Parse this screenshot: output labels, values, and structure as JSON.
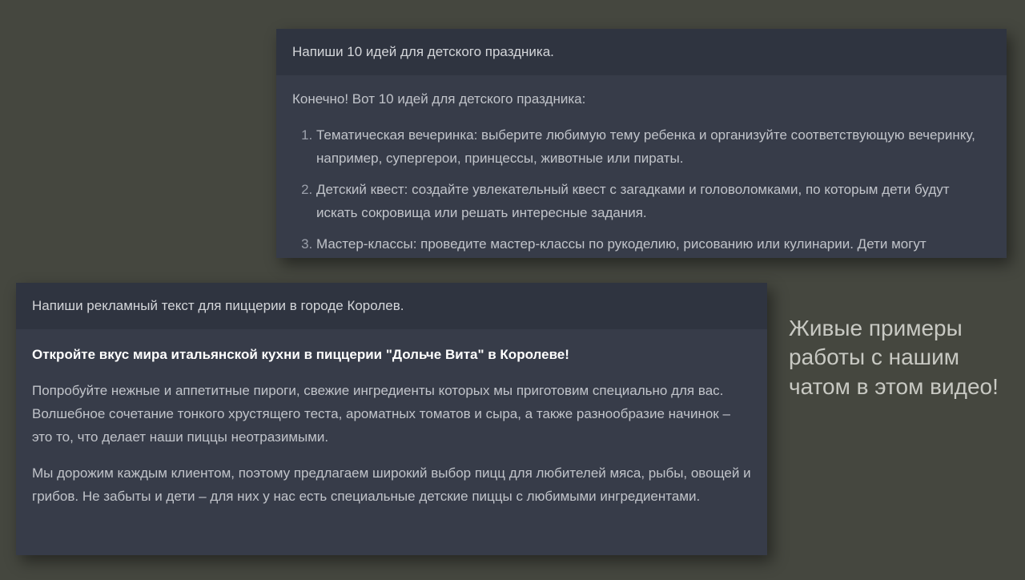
{
  "card1": {
    "prompt": "Напиши 10 идей для детского праздника.",
    "reply_intro": "Конечно! Вот 10 идей для детского праздника:",
    "items": [
      "Тематическая вечеринка: выберите любимую тему ребенка и организуйте соответствующую вечеринку, например, супергерои, принцессы, животные или пираты.",
      "Детский квест: создайте увлекательный квест с загадками и головоломками, по которым дети будут искать сокровища или решать интересные задания.",
      "Мастер-классы: проведите мастер-классы по рукоделию, рисованию или кулинарии. Дети могут"
    ]
  },
  "card2": {
    "prompt": "Напиши рекламный текст для пиццерии в городе Королев.",
    "headline": "Откройте вкус мира итальянской кухни в пиццерии \"Дольче Вита\" в Королеве!",
    "para1": "Попробуйте нежные и аппетитные пироги, свежие ингредиенты которых мы приготовим специально для вас. Волшебное сочетание тонкого хрустящего теста, ароматных томатов и сыра, а также разнообразие начинок – это то, что делает наши пиццы неотразимыми.",
    "para2": "Мы дорожим каждым клиентом, поэтому предлагаем широкий выбор пицц для любителей мяса, рыбы, овощей и грибов. Не забыты и дети – для них у нас есть специальные детские пиццы с любимыми ингредиентами."
  },
  "side_caption": "Живые примеры работы с нашим чатом в этом видео!"
}
